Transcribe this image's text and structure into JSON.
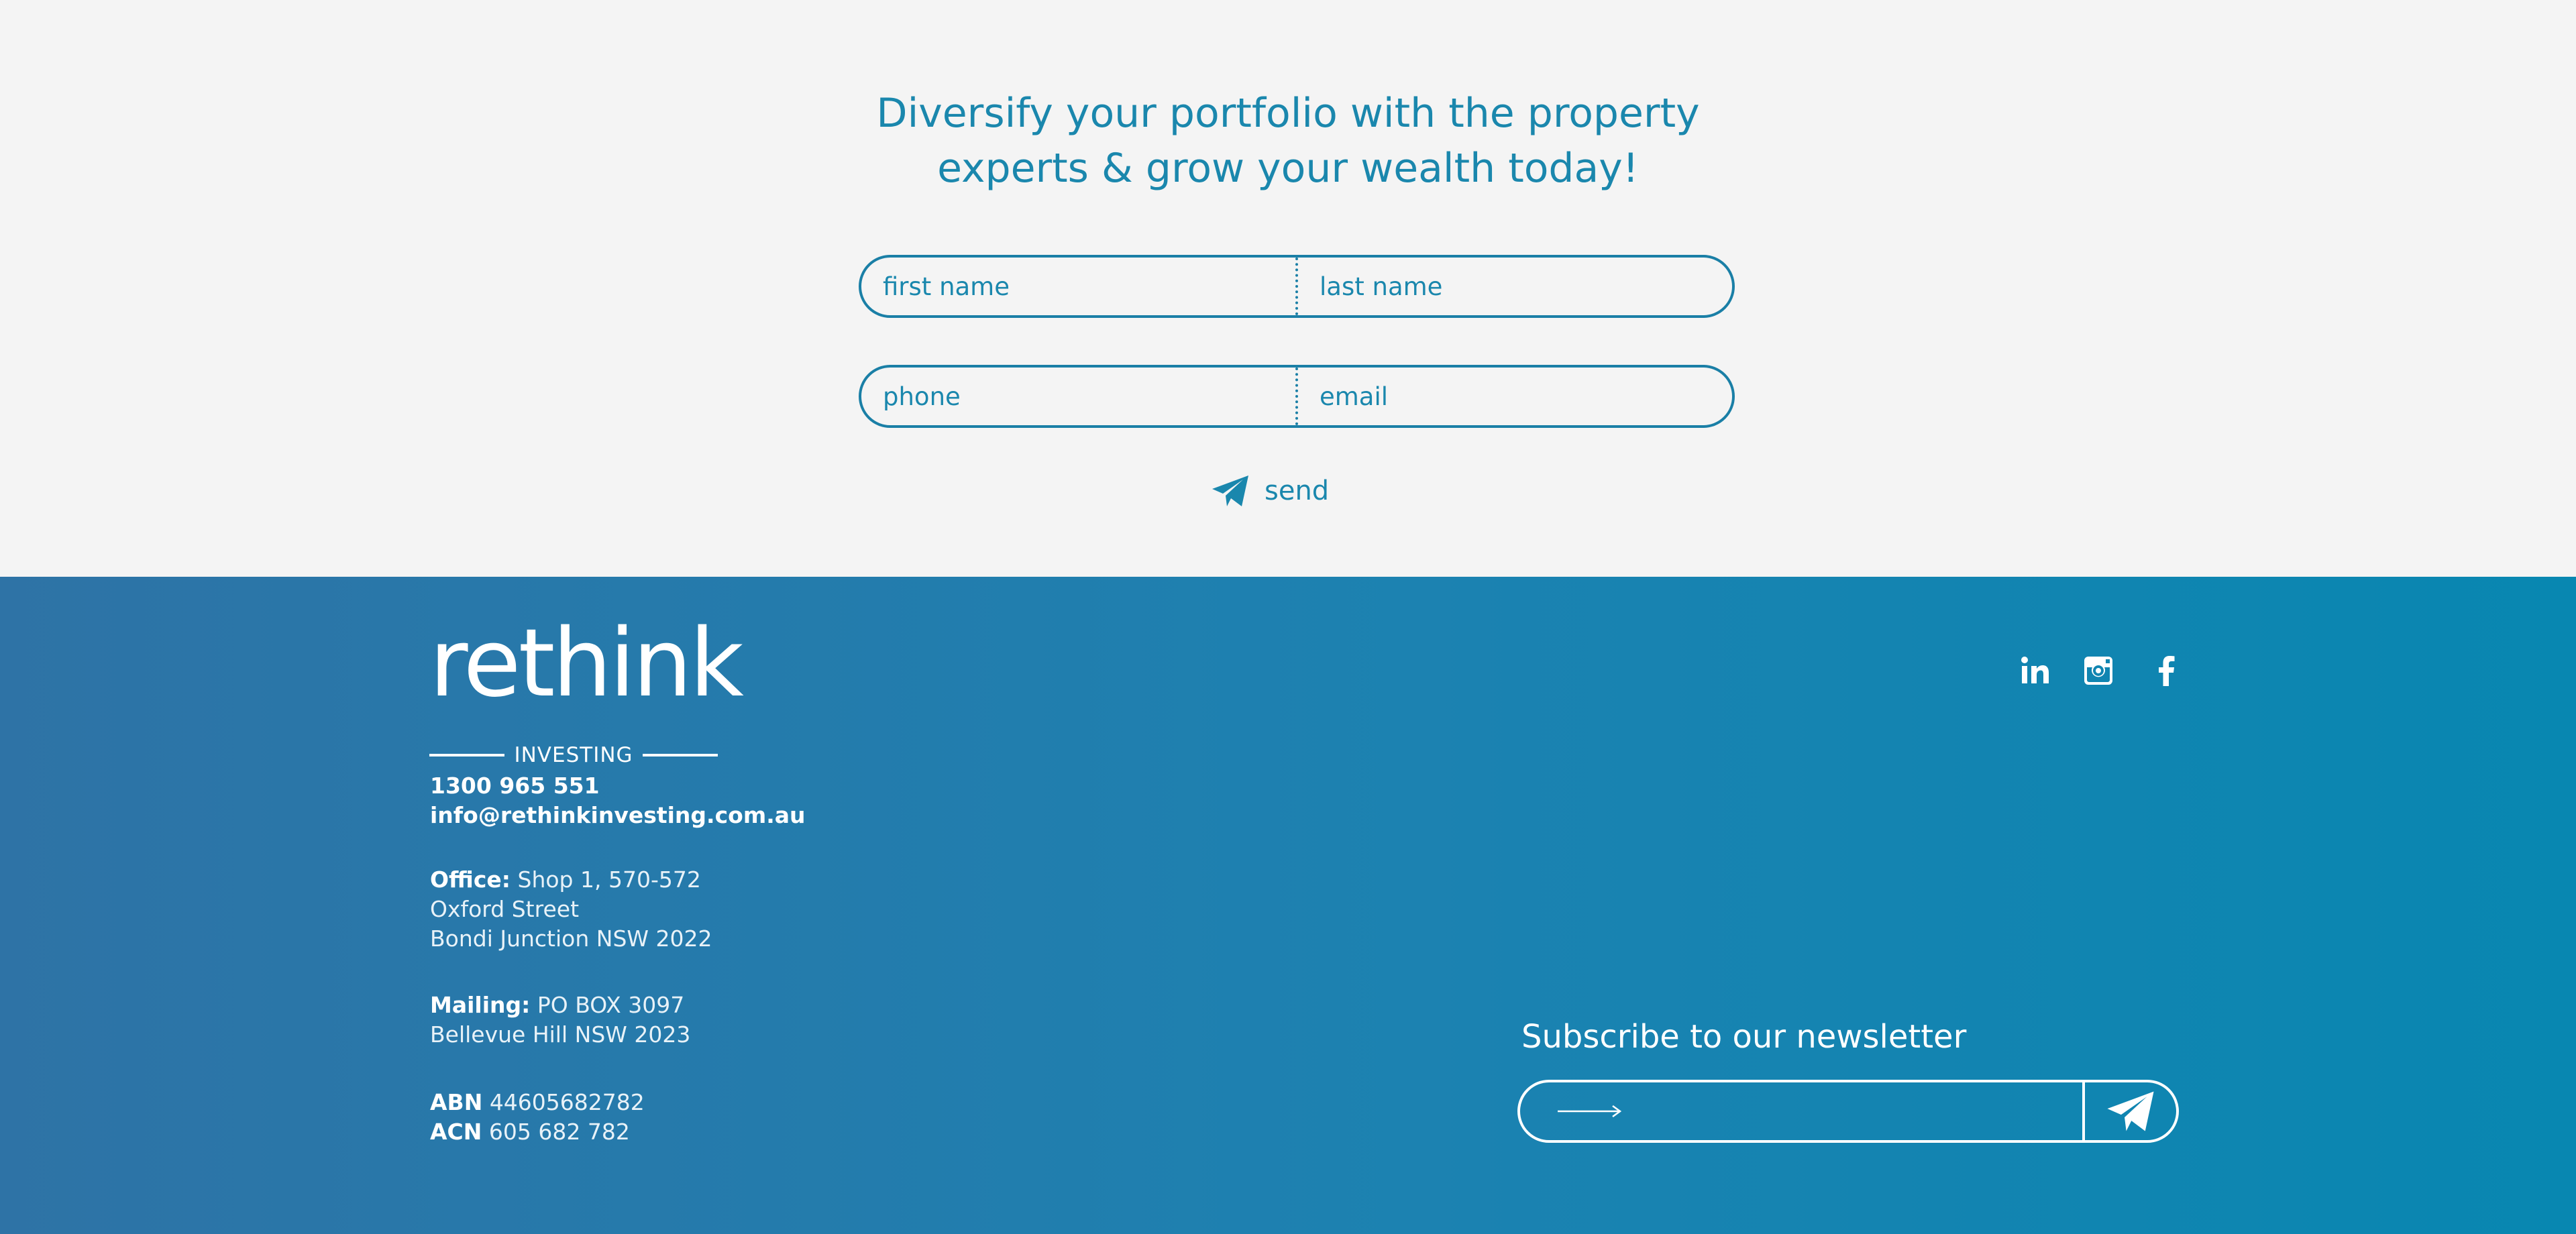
{
  "contact": {
    "headline_line1": "Diversify your portfolio with the property",
    "headline_line2": "experts & grow your wealth today!",
    "first_name_placeholder": "first name",
    "last_name_placeholder": "last name",
    "phone_placeholder": "phone",
    "email_placeholder": "email",
    "send_label": "send",
    "accent_color": "#1a87ad",
    "send_icon": "paper-plane-icon"
  },
  "footer": {
    "logo": {
      "word": "rethink",
      "sub": "INVESTING"
    },
    "phone": "1300 965 551",
    "email": "info@rethinkinvesting.com.au",
    "office_label": "Office:",
    "office_line1": "Shop 1, 570-572",
    "office_line2": "Oxford Street",
    "office_line3": "Bondi Junction NSW 2022",
    "mailing_label": "Mailing:",
    "mailing_line1": "PO BOX 3097",
    "mailing_line2": "Bellevue Hill NSW 2023",
    "abn_label": "ABN",
    "abn_value": "44605682782",
    "acn_label": "ACN",
    "acn_value": "605 682 782",
    "social": [
      "linkedin-icon",
      "instagram-icon",
      "facebook-icon"
    ],
    "newsletter_title": "Subscribe to our newsletter",
    "newsletter_icon": "arrow-right-icon",
    "gradient_colors": [
      "#2e73a6",
      "#0887b1"
    ]
  }
}
